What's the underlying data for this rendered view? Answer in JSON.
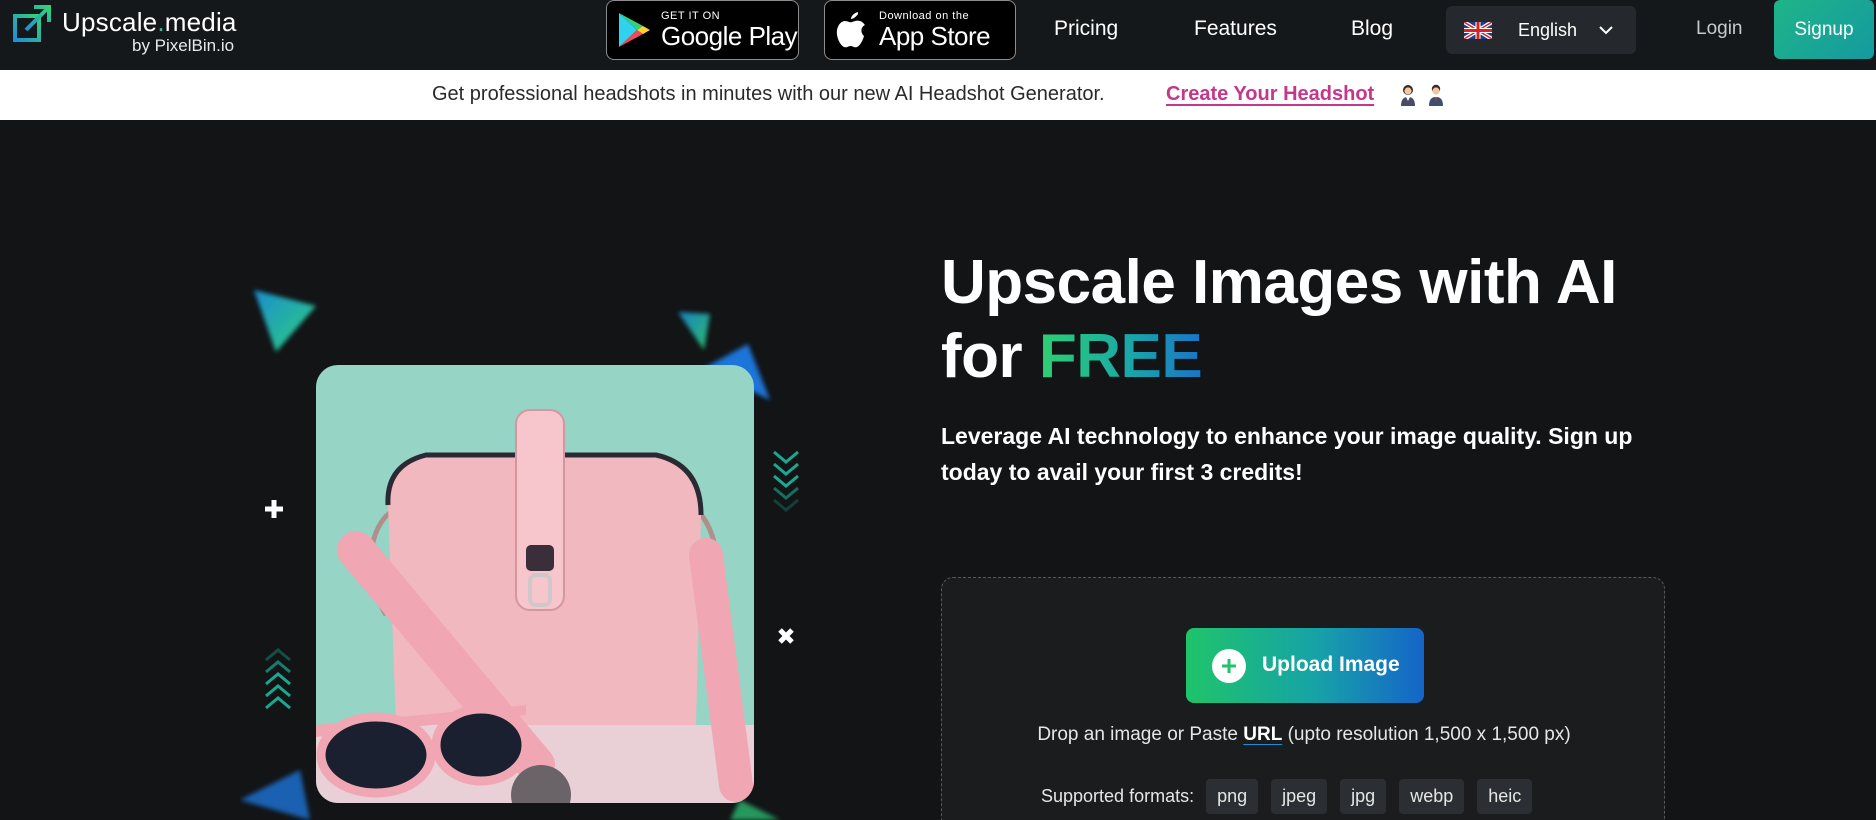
{
  "brand": {
    "name": "Upscale",
    "name_dot": ".",
    "name_suffix": "media",
    "by": "by PixelBin.io"
  },
  "stores": {
    "google_small": "GET IT ON",
    "google_big": "Google Play",
    "apple_small": "Download on the",
    "apple_big": "App Store"
  },
  "nav": {
    "pricing": "Pricing",
    "features": "Features",
    "blog": "Blog",
    "language": "English",
    "login": "Login",
    "signup": "Signup"
  },
  "announcement": {
    "text": "Get professional headshots in minutes with our new AI Headshot Generator.",
    "link": "Create Your Headshot"
  },
  "hero": {
    "title_line1": "Upscale Images with AI",
    "title_for": "for ",
    "title_free": "FREE",
    "subtitle": "Leverage AI technology to enhance your image quality. Sign up today to avail your first 3 credits!"
  },
  "upload": {
    "button": "Upload Image",
    "drop_prefix": "Drop an image or Paste ",
    "drop_url": "URL",
    "drop_suffix": " (upto resolution 1,500 x 1,500 px)",
    "formats_label": "Supported formats:",
    "formats": [
      "png",
      "jpeg",
      "jpg",
      "webp",
      "heic"
    ]
  },
  "colors": {
    "background": "#121416",
    "accent_green": "#2ed070",
    "accent_blue": "#1a73c8",
    "link_pink": "#c4378b"
  }
}
